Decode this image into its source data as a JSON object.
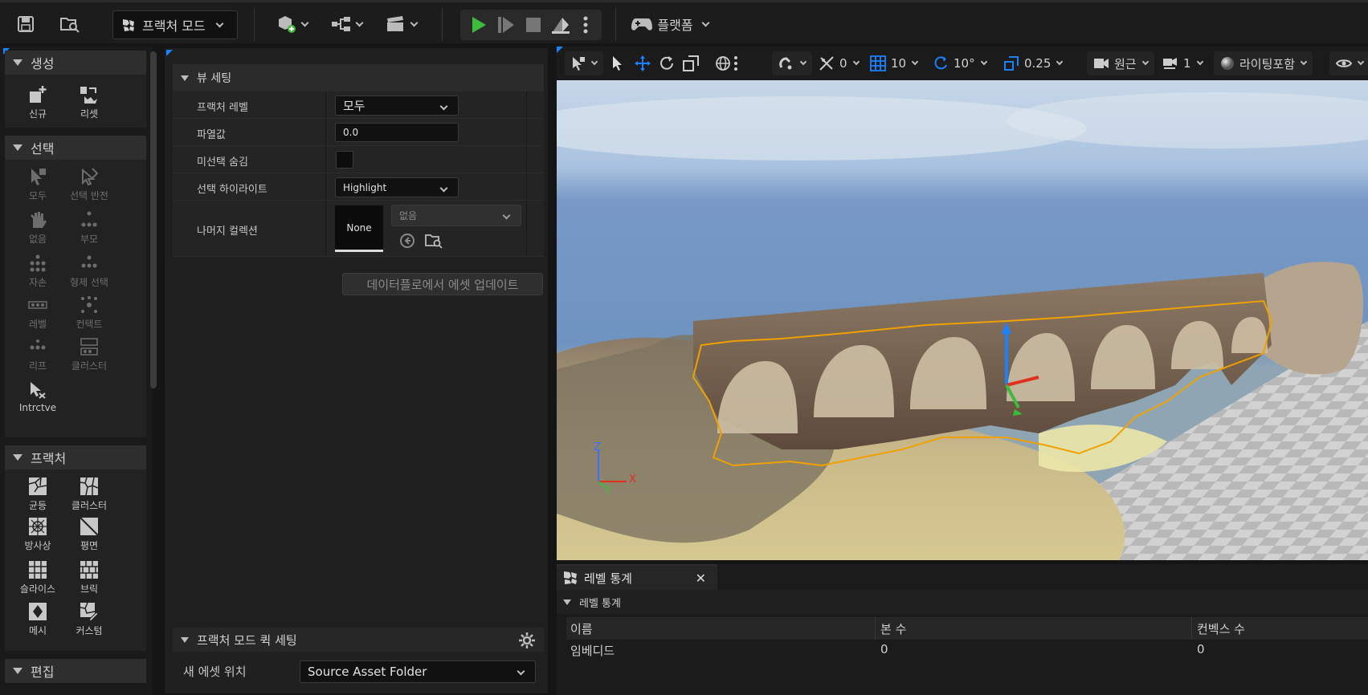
{
  "toolbar": {
    "mode_label": "프랙처 모드",
    "platform_label": "플랫폼"
  },
  "palette": {
    "create": {
      "title": "생성",
      "tools": [
        "신규",
        "리셋"
      ]
    },
    "select": {
      "title": "선택",
      "tools": [
        "모두",
        "선택 반전",
        "없음",
        "부모",
        "자손",
        "형제 선택",
        "레벨",
        "컨택트",
        "리프",
        "클러스터",
        "Intrctve"
      ]
    },
    "fracture": {
      "title": "프랙처",
      "tools": [
        "균등",
        "클러스터",
        "방사상",
        "평면",
        "슬라이스",
        "브릭",
        "메시",
        "커스텀"
      ]
    },
    "edit": {
      "title": "편집"
    }
  },
  "details": {
    "view_settings": {
      "title": "뷰 세팅",
      "fracture_level_label": "프랙처 레벨",
      "fracture_level_value": "모두",
      "explode_label": "파열값",
      "explode_value": "0.0",
      "hide_unselected_label": "미선택 숨김",
      "selection_highlight_label": "선택 하이라이트",
      "selection_highlight_value": "Highlight",
      "remainder_label": "나머지 컬렉션",
      "remainder_thumb": "None",
      "remainder_value": "없음"
    },
    "update_button": "데이터플로에서 에셋 업데이트",
    "quick_settings": {
      "title": "프랙처 모드 퀵 세팅",
      "new_asset_label": "새 에셋 위치",
      "new_asset_value": "Source Asset Folder"
    }
  },
  "viewport": {
    "rotation_snap_value": "0",
    "grid_snap": "10",
    "rotate_snap": "10°",
    "scale_snap": "0.25",
    "perspective": "원근",
    "camera_speed": "1",
    "view_mode": "라이팅포함",
    "axis": {
      "z": "Z",
      "x": "X",
      "y": "Y"
    }
  },
  "level_stats": {
    "tab_label": "레벨 통계",
    "section": "레벨 통계",
    "columns": [
      "이름",
      "본 수",
      "컨벡스 수"
    ],
    "rows": [
      [
        "임베디드",
        "0",
        "0"
      ]
    ]
  },
  "colors": {
    "accent": "#1b82ff",
    "selection": "#f0a100",
    "play": "#3dbb3d"
  }
}
